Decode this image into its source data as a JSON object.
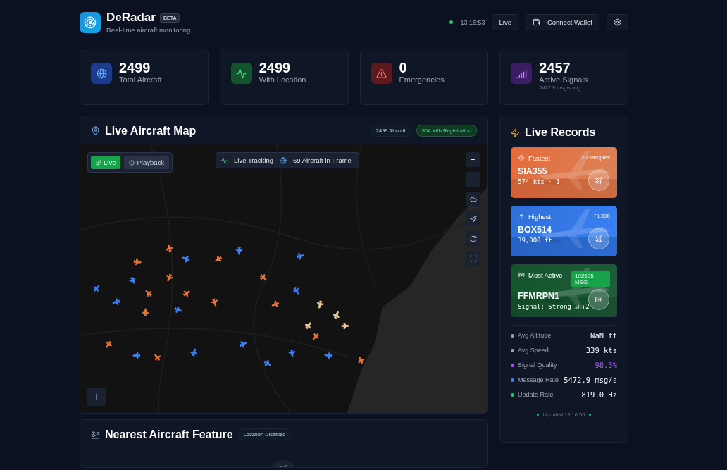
{
  "header": {
    "title": "DeRadar",
    "badge": "BETA",
    "subtitle": "Real-time aircraft monitoring",
    "status_time": "13:16:53",
    "live_button": "Live",
    "wallet_button": "Connect Wallet"
  },
  "stats": [
    {
      "kind": "globe",
      "value": "2499",
      "label": "Total Aircraft"
    },
    {
      "kind": "activity",
      "value": "2499",
      "label": "With Location"
    },
    {
      "kind": "alert",
      "value": "0",
      "label": "Emergencies"
    },
    {
      "kind": "signal",
      "value": "2457",
      "label": "Active Signals",
      "note": "5472.9 msg/s avg"
    }
  ],
  "map_panel": {
    "title": "Live Aircraft Map",
    "count_badge": "2499 Aircraft",
    "registration_badge": "854 with Registration",
    "modes": [
      {
        "label": "Live",
        "selected": true
      },
      {
        "label": "Playback",
        "selected": false
      }
    ],
    "tracking": "Live Tracking",
    "in_frame": "69 Aircraft in Frame",
    "zoom_in": "+",
    "zoom_out": "-",
    "info": "i",
    "markers": [
      {
        "color": "#3b82f6"
      },
      {
        "color": "#e8743b"
      },
      {
        "color": "#3b82f6"
      },
      {
        "color": "#e8743b"
      },
      {
        "color": "#3b82f6"
      },
      {
        "color": "#e8743b"
      },
      {
        "color": "#e8743b"
      },
      {
        "color": "#e8743b"
      },
      {
        "color": "#3b82f6"
      },
      {
        "color": "#e8743b"
      },
      {
        "color": "#e8743b"
      },
      {
        "color": "#3b82f6"
      },
      {
        "color": "#e8743b"
      },
      {
        "color": "#3b82f6"
      },
      {
        "color": "#3b82f6"
      },
      {
        "color": "#3b82f6"
      },
      {
        "color": "#3b82f6"
      },
      {
        "color": "#e8743b"
      },
      {
        "color": "#3b82f6"
      },
      {
        "color": "#e8743b"
      },
      {
        "color": "#e8c9a0"
      },
      {
        "color": "#3b82f6"
      },
      {
        "color": "#e8743b"
      },
      {
        "color": "#3b82f6"
      },
      {
        "color": "#e8743b"
      },
      {
        "color": "#3b82f6"
      },
      {
        "color": "#e8743b"
      },
      {
        "color": "#e8c9a0"
      },
      {
        "color": "#e8c9a0"
      },
      {
        "color": "#3b82f6"
      },
      {
        "color": "#e8c9a0"
      },
      {
        "color": "#e8743b"
      }
    ]
  },
  "records": {
    "title": "Live Records",
    "cards": [
      {
        "kind": "fastest",
        "label": "Fastest",
        "tag": "20 samples",
        "callsign": "SIA355",
        "detail": "574 kts · 1"
      },
      {
        "kind": "highest",
        "label": "Highest",
        "tag": "FL390",
        "callsign": "BOX514",
        "detail": "39,000 ft"
      },
      {
        "kind": "active",
        "label": "Most Active",
        "tag": "192585 MSG",
        "callsign": "FFMRPN1",
        "detail": "Signal: Strong",
        "extra": "+2"
      }
    ],
    "metrics": [
      {
        "label": "Avg Altitude",
        "value": "NaN ft",
        "color": "#9ca3af",
        "highlight": false
      },
      {
        "label": "Avg Speed",
        "value": "339 kts",
        "color": "#9ca3af",
        "highlight": false
      },
      {
        "label": "Signal Quality",
        "value": "98.3%",
        "color": "#a855f7",
        "highlight": true
      },
      {
        "label": "Message Rate",
        "value": "5472.9 msg/s",
        "color": "#3b82f6",
        "highlight": false
      },
      {
        "label": "Update Rate",
        "value": "819.0 Hz",
        "color": "#22c55e",
        "highlight": false
      }
    ],
    "updated": "Updated 13:16:55"
  },
  "nearest": {
    "title": "Nearest Aircraft Feature",
    "badge": "Location Disabled"
  }
}
